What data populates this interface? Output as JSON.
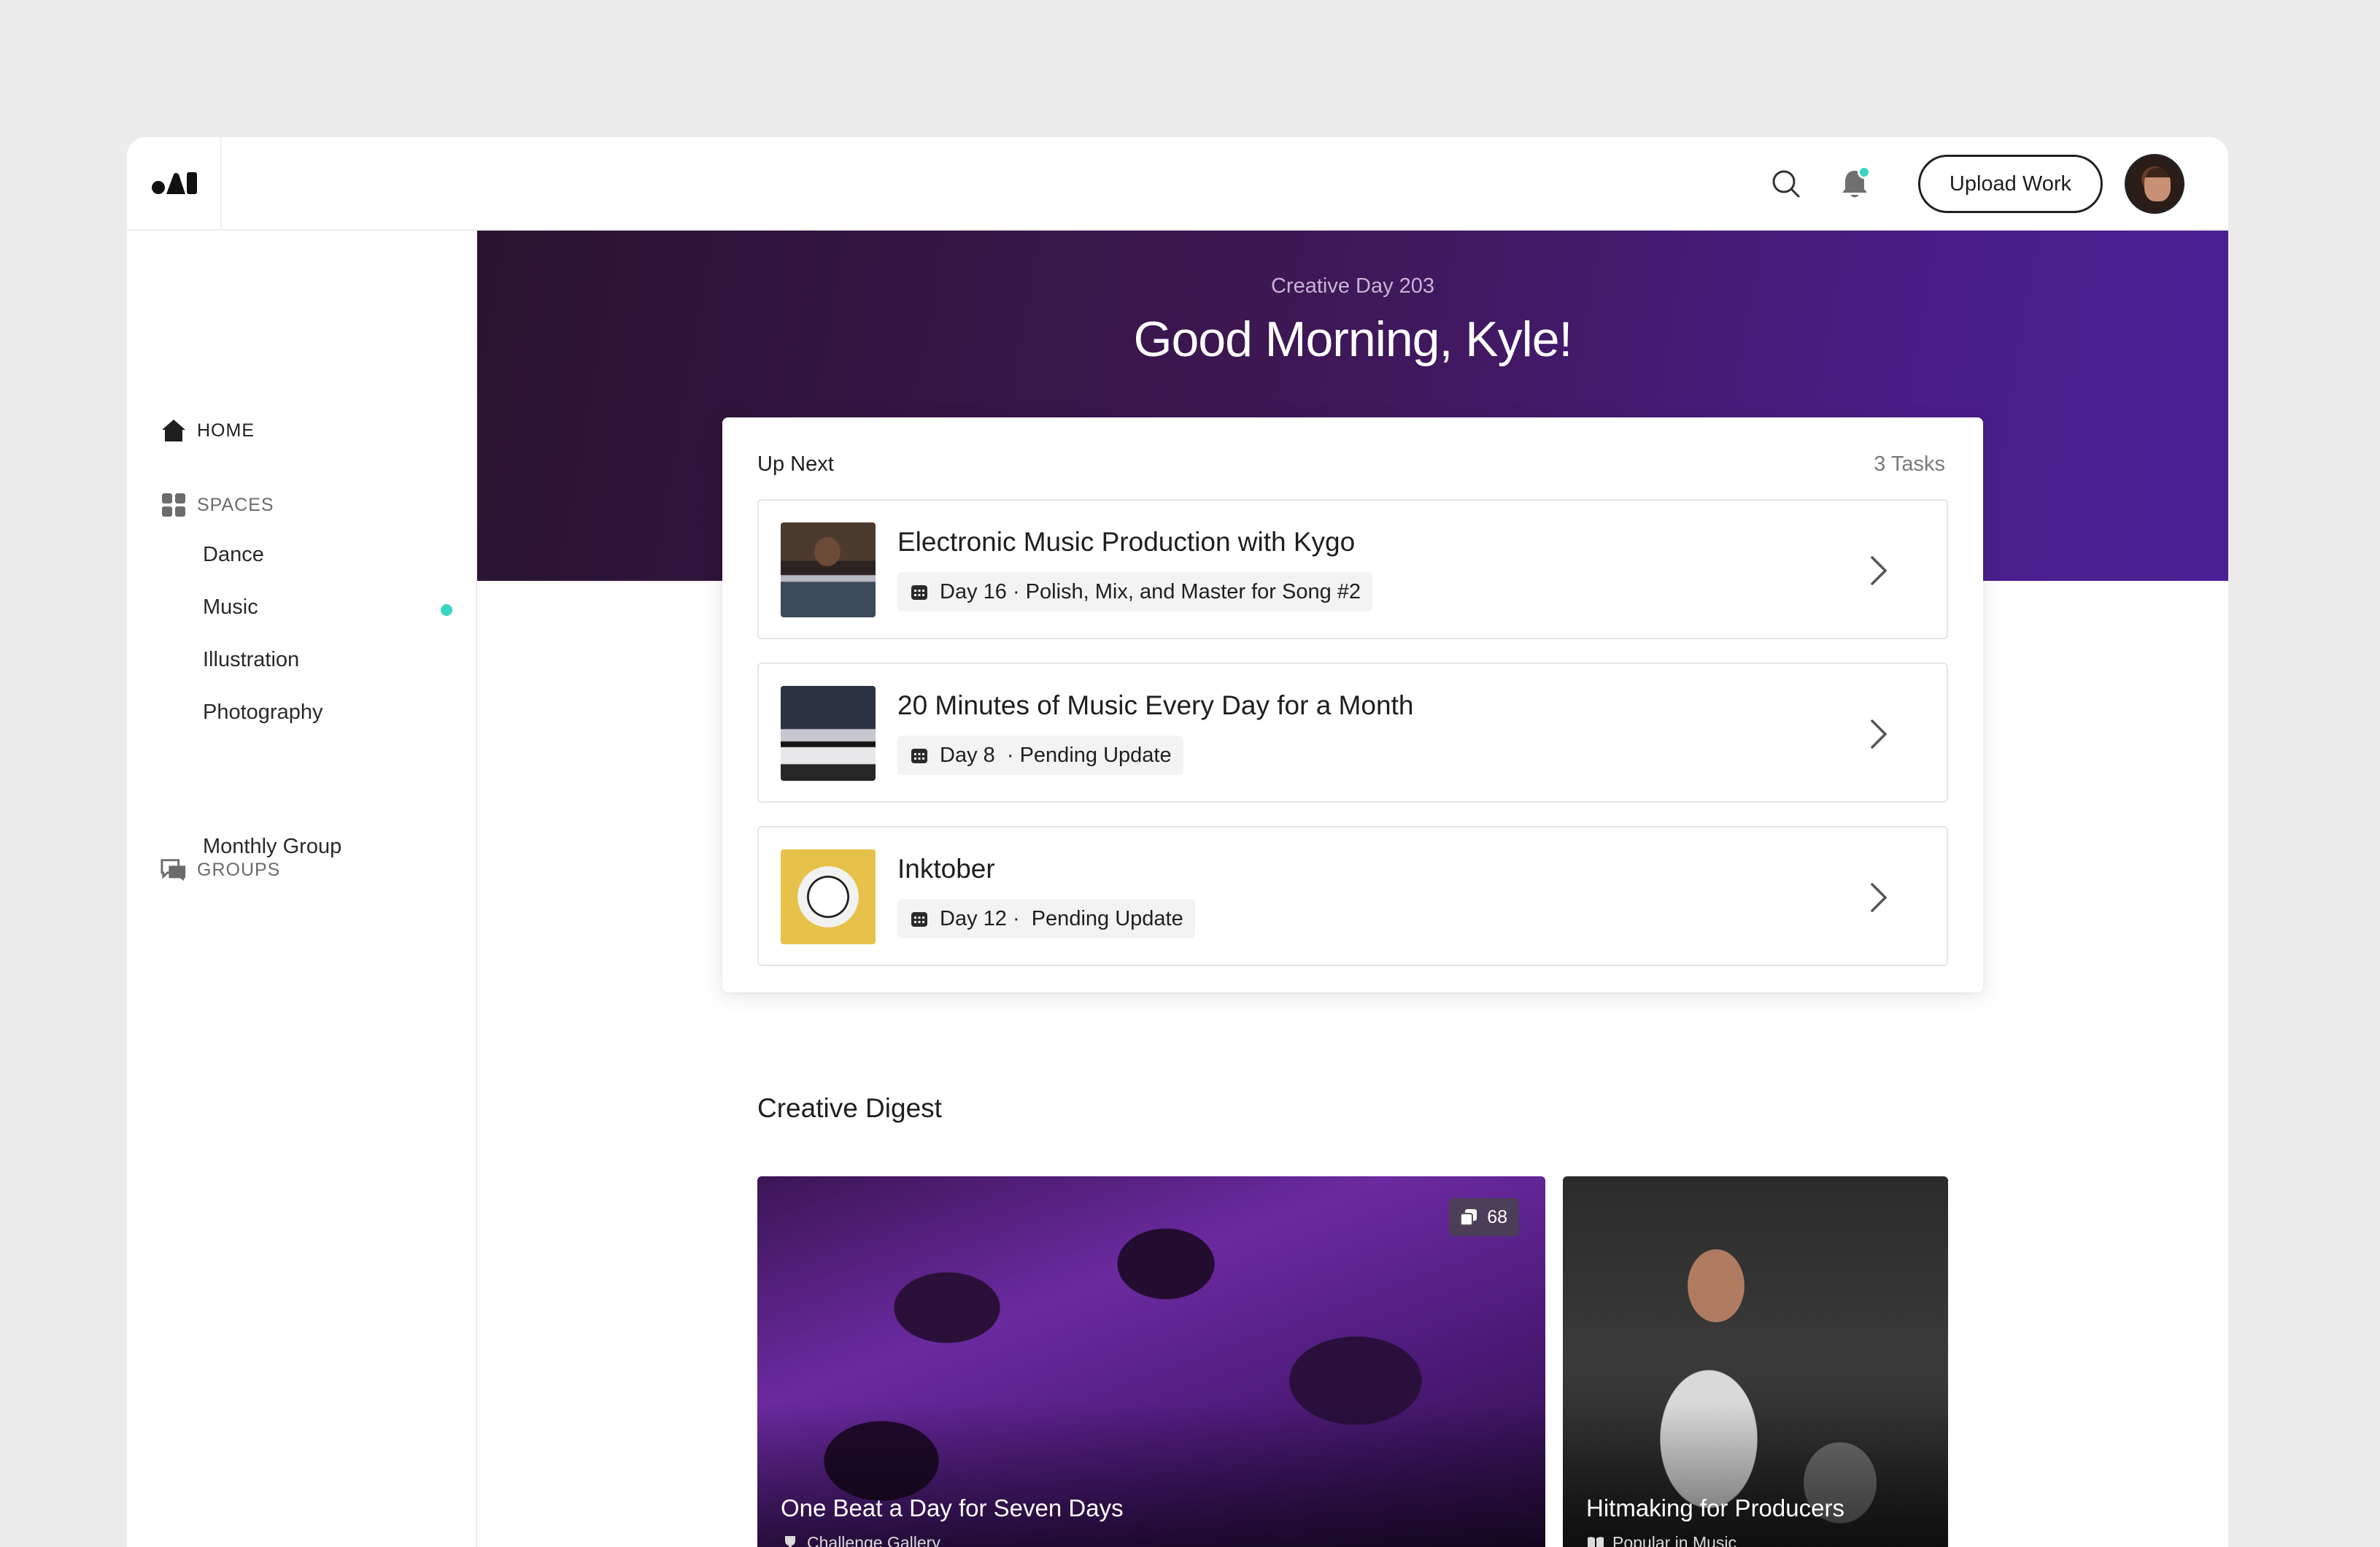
{
  "topbar": {
    "upload_label": "Upload Work"
  },
  "sidebar": {
    "home_label": "HOME",
    "spaces_label": "SPACES",
    "spaces": [
      "Dance",
      "Music",
      "Illustration",
      "Photography"
    ],
    "groups_label": "GROUPS",
    "groups": [
      "Monthly Group"
    ]
  },
  "hero": {
    "subtitle": "Creative Day 203",
    "title": "Good Morning, Kyle!"
  },
  "upnext": {
    "label": "Up Next",
    "count": "3 Tasks",
    "tasks": [
      {
        "title": "Electronic Music Production with Kygo",
        "meta": "Day 16 · Polish, Mix, and Master for Song #2"
      },
      {
        "title": "20 Minutes of Music Every Day for a Month",
        "meta": "Day 8  · Pending Update"
      },
      {
        "title": "Inktober",
        "meta": "Day 12 ·  Pending Update"
      }
    ]
  },
  "digest": {
    "title": "Creative Digest",
    "cards": [
      {
        "title": "One Beat a Day for Seven Days",
        "subtitle": "Challenge Gallery",
        "count": "68"
      },
      {
        "title": "Hitmaking for Producers",
        "subtitle": "Popular in Music"
      }
    ]
  },
  "colors": {
    "accent": "#37d6c0",
    "hero_start": "#2a1330",
    "hero_end": "#4a2095"
  }
}
